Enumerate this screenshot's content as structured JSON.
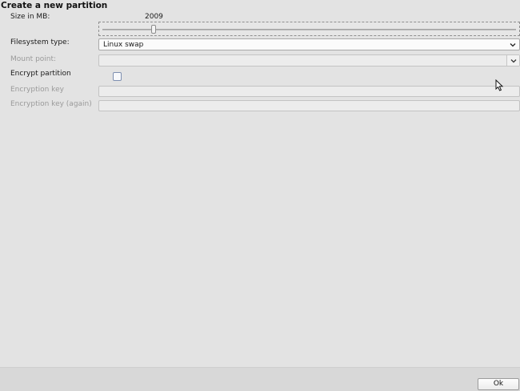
{
  "dialog": {
    "title": "Create a new partition"
  },
  "size": {
    "label": "Size in MB:",
    "value": "2009",
    "slider_fraction": 0.12
  },
  "filesystem": {
    "label": "Filesystem type:",
    "selected": "Linux swap",
    "arrow_icon": "chevron-down-icon"
  },
  "mount_point": {
    "label": "Mount point:",
    "value": "",
    "arrow_icon": "chevron-down-icon"
  },
  "encrypt": {
    "label": "Encrypt partition",
    "checked": false
  },
  "encryption_key": {
    "label": "Encryption key",
    "value": ""
  },
  "encryption_key_again": {
    "label": "Encryption key (again)",
    "value": ""
  },
  "footer": {
    "ok_label": "Ok"
  },
  "icons": {
    "pointer": "mouse-pointer-icon"
  }
}
